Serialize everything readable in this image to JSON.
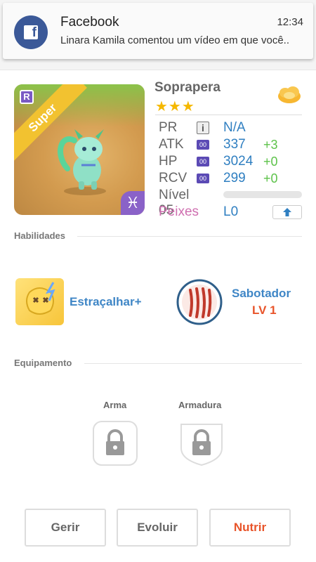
{
  "notification": {
    "app": "Facebook",
    "time": "12:34",
    "message": "Linara Kamila comentou um vídeo em que você..",
    "app_icon": "facebook-icon",
    "brand_color": "#3b5998"
  },
  "card": {
    "badge_letter": "R",
    "ribbon_label": "Super",
    "element_icon": "pisces-icon",
    "element_glyph": "♓"
  },
  "monster": {
    "name": "Soprapera",
    "stars": "★★★",
    "class_icon": "cloud-icon"
  },
  "stats": {
    "pr": {
      "label": "PR",
      "value": "N/A",
      "icon": "info-icon",
      "icon_glyph": "i"
    },
    "atk": {
      "label": "ATK",
      "badge": "00",
      "value": "337",
      "bonus": "+3"
    },
    "hp": {
      "label": "HP",
      "badge": "00",
      "value": "3024",
      "bonus": "+0"
    },
    "rcv": {
      "label": "RCV",
      "badge": "00",
      "value": "299",
      "bonus": "+0"
    },
    "level": {
      "label": "Nível 05",
      "progress": 0
    },
    "fish": {
      "label": "Peixes",
      "value": "L0",
      "icon": "upgrade-arrow-icon"
    }
  },
  "sections": {
    "skills_title": "Habilidades",
    "equipment_title": "Equipamento"
  },
  "skills": [
    {
      "name": "Estraçalhar+",
      "icon": "dizzy-face-skill-icon"
    },
    {
      "name": "Sabotador",
      "level": "LV 1",
      "icon": "claw-marks-icon"
    }
  ],
  "equipment": {
    "weapon_label": "Arma",
    "armor_label": "Armadura",
    "weapon_icon": "lock-icon",
    "armor_icon": "lock-icon"
  },
  "buttons": {
    "manage": "Gerir",
    "evolve": "Evoluir",
    "feed": "Nutrir"
  },
  "colors": {
    "accent_blue": "#2f7fc1",
    "accent_orange": "#e8542a",
    "bonus_green": "#5cc249",
    "star_gold": "#f5b800"
  }
}
